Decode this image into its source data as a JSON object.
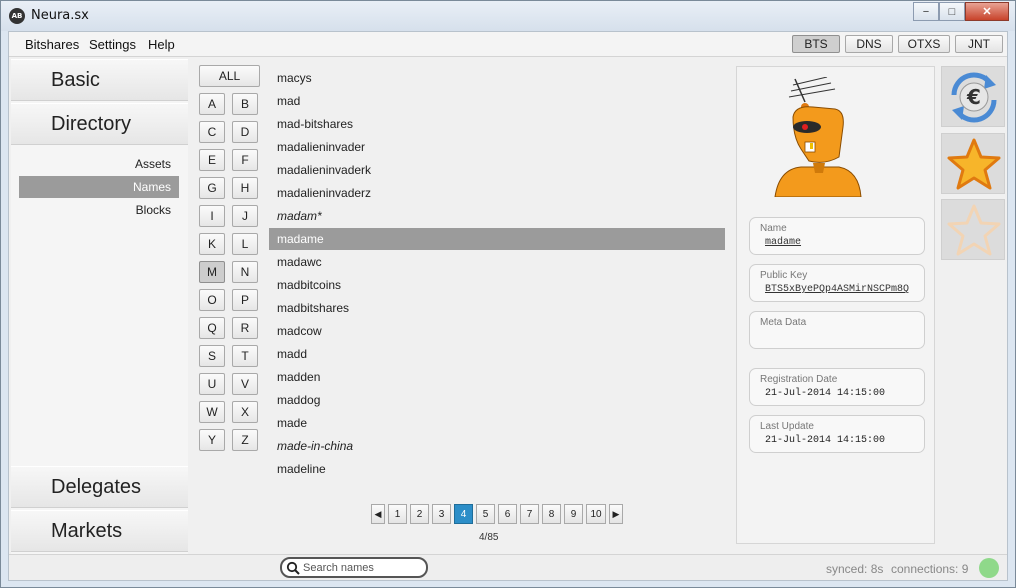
{
  "window": {
    "title": "Neura.sx",
    "app_icon": "neura-logo-icon"
  },
  "window_controls": {
    "minimize": "−",
    "maximize": "□",
    "close": "✕"
  },
  "menu": {
    "items": [
      "Bitshares",
      "Settings",
      "Help"
    ]
  },
  "networks": {
    "tabs": [
      "BTS",
      "DNS",
      "OTXS",
      "JNT"
    ],
    "active": "BTS"
  },
  "nav": {
    "sections": [
      "Basic",
      "Directory",
      "Delegates",
      "Markets"
    ],
    "directory_items": [
      "Assets",
      "Names",
      "Blocks"
    ],
    "selected_item": "Names"
  },
  "letters": {
    "all_label": "ALL",
    "items": [
      "A",
      "B",
      "C",
      "D",
      "E",
      "F",
      "G",
      "H",
      "I",
      "J",
      "K",
      "L",
      "M",
      "N",
      "O",
      "P",
      "Q",
      "R",
      "S",
      "T",
      "U",
      "V",
      "W",
      "X",
      "Y",
      "Z"
    ],
    "selected": "M"
  },
  "names": {
    "items": [
      {
        "name": "macys",
        "italic": false
      },
      {
        "name": "mad",
        "italic": false
      },
      {
        "name": "mad-bitshares",
        "italic": false
      },
      {
        "name": "madalieninvader",
        "italic": false
      },
      {
        "name": "madalieninvaderk",
        "italic": false
      },
      {
        "name": "madalieninvaderz",
        "italic": false
      },
      {
        "name": "madam*",
        "italic": true
      },
      {
        "name": "madame",
        "italic": false
      },
      {
        "name": "madawc",
        "italic": false
      },
      {
        "name": "madbitcoins",
        "italic": false
      },
      {
        "name": "madbitshares",
        "italic": false
      },
      {
        "name": "madcow",
        "italic": false
      },
      {
        "name": "madd",
        "italic": false
      },
      {
        "name": "madden",
        "italic": false
      },
      {
        "name": "maddog",
        "italic": false
      },
      {
        "name": "made",
        "italic": false
      },
      {
        "name": "made-in-china",
        "italic": true
      },
      {
        "name": "madeline",
        "italic": false
      }
    ],
    "selected": "madame"
  },
  "pagination": {
    "prev": "◀",
    "next": "▶",
    "pages": [
      "1",
      "2",
      "3",
      "4",
      "5",
      "6",
      "7",
      "8",
      "9",
      "10"
    ],
    "current": "4",
    "count_text": "4/85"
  },
  "detail": {
    "avatar": "robot-avatar-icon",
    "name_label": "Name",
    "name_value": "madame",
    "pubkey_label": "Public Key",
    "pubkey_value": "BTS5xByePQp4ASMirNSCPm8Q",
    "meta_label": "Meta Data",
    "meta_value": "",
    "reg_label": "Registration Date",
    "reg_value": "21-Jul-2014 14:15:00",
    "update_label": "Last Update",
    "update_value": "21-Jul-2014 14:15:00"
  },
  "side_icons": [
    "currency-exchange-icon",
    "favorite-star-icon",
    "star-outline-icon"
  ],
  "status": {
    "search_placeholder": "Search names",
    "synced": "synced: 8s",
    "connections": "connections: 9",
    "connection_color": "#8fd98a"
  }
}
